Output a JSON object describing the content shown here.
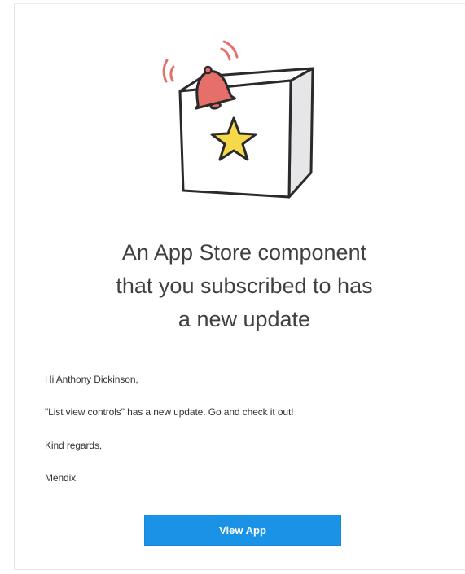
{
  "illustration": {
    "icon": "gift-box-with-star-and-bell",
    "colors": {
      "outline": "#2a2a2a",
      "box_front": "#ffffff",
      "box_side": "#e6e6e8",
      "star": "#f6d94a",
      "bell": "#e76f6a",
      "ring_lines": "#e76f6a"
    }
  },
  "headline": {
    "line1": "An App Store component",
    "line2": "that you subscribed to has",
    "line3": "a new update"
  },
  "body": {
    "greeting": "Hi Anthony Dickinson,",
    "message": "\"List view controls\" has a new update. Go and check it out!",
    "regards": "Kind regards,",
    "signoff": "Mendix"
  },
  "cta": {
    "label": "View App",
    "color": "#1a93e6"
  }
}
